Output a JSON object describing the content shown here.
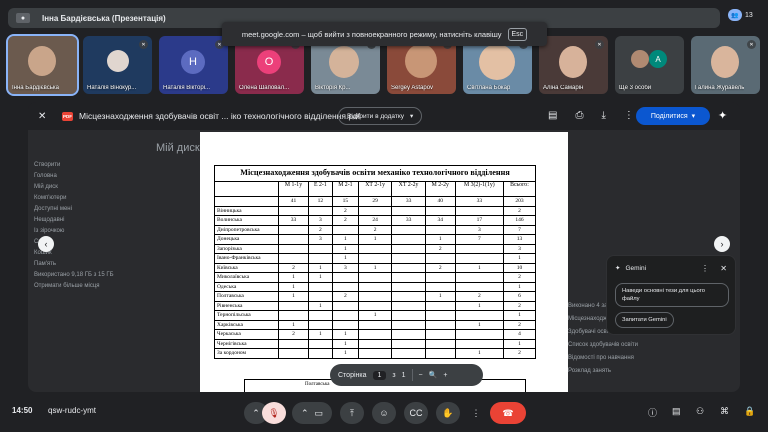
{
  "meeting": {
    "presenter_bar": "Інна Бардієвська (Презентація)",
    "people_count": "13",
    "fullscreen_toast": "meet.google.com – щоб вийти з повноекранного режиму, натисніть клавішу",
    "esc_key": "Esc",
    "time": "14:50",
    "meeting_code": "qsw-rudc-ymt"
  },
  "participants": [
    {
      "name": "Інна Бардієвська",
      "avatar_letter": ""
    },
    {
      "name": "Наталія Вінокур...",
      "avatar_letter": ""
    },
    {
      "name": "Наталія Вікторі...",
      "avatar_letter": "Н",
      "color": "#5c6bc0"
    },
    {
      "name": "Олена Шаповал...",
      "avatar_letter": "О",
      "color": "#ec407a"
    },
    {
      "name": "Вікторія Кр...",
      "avatar_letter": ""
    },
    {
      "name": "Sergey Astapov",
      "avatar_letter": ""
    },
    {
      "name": "Світлана Бокар",
      "avatar_letter": ""
    },
    {
      "name": "Аліна Самарін",
      "avatar_letter": ""
    },
    {
      "name": "Ще 3 особи",
      "avatar_letter": "A",
      "color": "#00897b"
    },
    {
      "name": "Галина Журавель",
      "avatar_letter": ""
    }
  ],
  "viewer": {
    "file_name": "Місцезнаходження здобувачів освіт ... іко технологічного відділення.pdf",
    "open_with": "Відкрити в додатку",
    "share": "Поділитися",
    "pdf_label": "PDF"
  },
  "background": {
    "left_items": [
      "Створити",
      "Головна",
      "Мій диск",
      "Комп'ютери",
      "Доступні мені",
      "Нещодавні",
      "Із зірочкою",
      "Спам",
      "Кошик",
      "Пам'ять",
      "Використано 9,18 ГБ з 15 ГБ",
      "Отримати більше місця"
    ],
    "title": "Мій диск",
    "right_items": [
      "Виконано 4 завантаження",
      "Місцезнаходження здобувачів",
      "Здобувачі освіти 2024-2025",
      "Список здобувачів освіти",
      "Відомості про навчання",
      "Розклад занять"
    ]
  },
  "document": {
    "title": "Місцезнаходження здобувачів освіти механіко технологічного відділення",
    "columns": [
      "",
      "М 1-1у",
      "Е 2-1",
      "М 2-1",
      "ХТ 2-1у",
      "ХТ 2-2у",
      "М 2-2у",
      "М 3(2)-1(1у)",
      "Всього:"
    ],
    "totals_row": [
      "",
      "41",
      "12",
      "15",
      "29",
      "33",
      "40",
      "33",
      "203"
    ],
    "rows": [
      [
        "Вінницька",
        "",
        "",
        "2",
        "",
        "",
        "",
        "",
        "2"
      ],
      [
        "Волинська",
        "33",
        "3",
        "2",
        "24",
        "33",
        "34",
        "17",
        "146"
      ],
      [
        "Дніпропетровська",
        "",
        "2",
        "",
        "2",
        "",
        "",
        "3",
        "7"
      ],
      [
        "Донецька",
        "",
        "3",
        "1",
        "1",
        "",
        "1",
        "7",
        "13"
      ],
      [
        "Запорізька",
        "",
        "",
        "1",
        "",
        "",
        "2",
        "",
        "3"
      ],
      [
        "Івано-Франківська",
        "",
        "",
        "1",
        "",
        "",
        "",
        "",
        "1"
      ],
      [
        "Київська",
        "2",
        "1",
        "3",
        "1",
        "",
        "2",
        "1",
        "10"
      ],
      [
        "Миколаївська",
        "1",
        "1",
        "",
        "",
        "",
        "",
        "",
        "2"
      ],
      [
        "Одеська",
        "1",
        "",
        "",
        "",
        "",
        "",
        "",
        "1"
      ],
      [
        "Полтавська",
        "1",
        "",
        "2",
        "",
        "",
        "1",
        "2",
        "6"
      ],
      [
        "Рівненська",
        "",
        "1",
        "",
        "",
        "",
        "",
        "1",
        "2"
      ],
      [
        "Тернопільська",
        "",
        "",
        "",
        "1",
        "",
        "",
        "",
        "1"
      ],
      [
        "Харківська",
        "1",
        "",
        "",
        "",
        "",
        "",
        "1",
        "2"
      ],
      [
        "Черкаська",
        "2",
        "1",
        "1",
        "",
        "",
        "",
        "",
        "4"
      ],
      [
        "Чернігівська",
        "",
        "",
        "1",
        "",
        "",
        "",
        "",
        "1"
      ],
      [
        "За кордоном",
        "",
        "",
        "1",
        "",
        "",
        "",
        "1",
        "2"
      ]
    ],
    "next_table_cols": [
      "Полтавська",
      "Чернігівська"
    ]
  },
  "pager": {
    "label": "Сторінка",
    "current": "1",
    "of": "з",
    "total": "1"
  },
  "gemini": {
    "title": "Gemini",
    "suggestion_1": "Наведи основні тези для цього файлу",
    "suggestion_2": "Запитати Gemini"
  }
}
